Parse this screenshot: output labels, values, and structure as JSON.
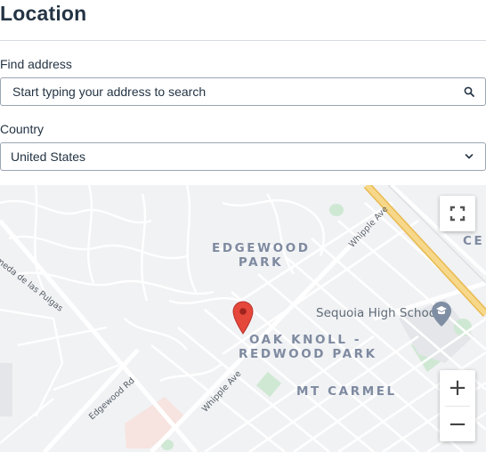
{
  "header": {
    "title": "Location"
  },
  "address": {
    "label": "Find address",
    "placeholder": "Start typing your address to search",
    "search_icon": "search-icon"
  },
  "country": {
    "label": "Country",
    "value": "United States",
    "chevron_icon": "chevron-down-icon"
  },
  "map": {
    "neighborhoods": {
      "edgewood": "EDGEWOOD\nPARK",
      "oak_knoll": "OAK KNOLL -\nREDWOOD PARK",
      "mt_carmel": "MT CARMEL",
      "cut_off": "CE"
    },
    "streets": {
      "alameda": "Alameda de las Pulgas",
      "whipple_upper": "Whipple Ave",
      "whipple_lower": "Whipple Ave",
      "edgewood_rd": "Edgewood Rd"
    },
    "poi": {
      "school": "Sequoia High School"
    },
    "controls": {
      "fullscreen_icon": "fullscreen-icon",
      "zoom_in": "+",
      "zoom_out": "−"
    },
    "marker_color": "#e5473b",
    "highway_color": "#f5cf6b"
  }
}
